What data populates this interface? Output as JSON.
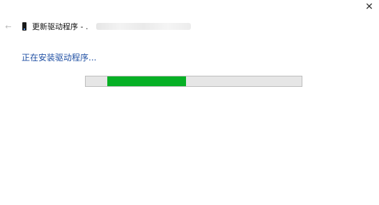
{
  "window": {
    "close_icon": "close-icon",
    "close_glyph": "✕"
  },
  "header": {
    "back_icon": "back-arrow-icon",
    "back_glyph": "←",
    "device_icon": "phone-icon",
    "title": "更新驱动程序 - ."
  },
  "main": {
    "status": "正在安装驱动程序...",
    "progress": {
      "type": "marquee",
      "fill_start_fraction": 0.1,
      "fill_end_fraction": 0.465,
      "fill_color": "#06b025",
      "track_color": "#e6e6e6",
      "border_color": "#bdbdbd"
    }
  },
  "colors": {
    "status_text": "#1f4fa3",
    "background": "#ffffff"
  }
}
